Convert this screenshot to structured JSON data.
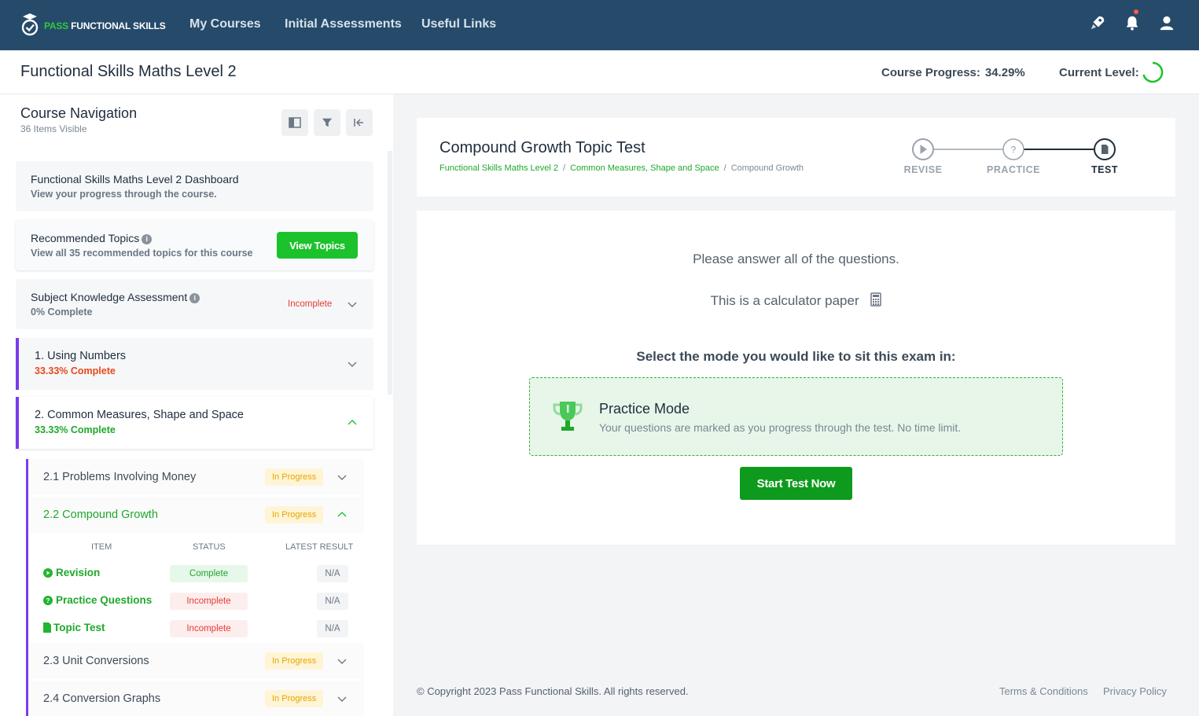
{
  "brand": {
    "logo_accent": "PASS",
    "logo_main": "FUNCTIONAL SKILLS"
  },
  "nav": {
    "my_courses": "My Courses",
    "initial_assessments": "Initial Assessments",
    "useful_links": "Useful Links"
  },
  "course": {
    "title": "Functional Skills Maths Level 2",
    "progress_label": "Course Progress:",
    "progress_value": "34.29%",
    "level_label": "Current Level:"
  },
  "sidebar": {
    "title": "Course Navigation",
    "subtitle": "36 Items Visible",
    "dashboard": {
      "title": "Functional Skills Maths Level 2 Dashboard",
      "subtitle": "View your progress through the course."
    },
    "recommended": {
      "title": "Recommended Topics",
      "subtitle": "View all 35 recommended topics for this course",
      "button": "View Topics"
    },
    "ska": {
      "title": "Subject Knowledge Assessment",
      "subtitle": "0% Complete",
      "status": "Incomplete"
    },
    "modules": [
      {
        "title": "1. Using Numbers",
        "progress": "33.33% Complete"
      },
      {
        "title": "2. Common Measures, Shape and Space",
        "progress": "33.33% Complete"
      }
    ],
    "topics": [
      {
        "title": "2.1 Problems Involving Money",
        "status": "In Progress"
      },
      {
        "title": "2.2 Compound Growth",
        "status": "In Progress"
      },
      {
        "title": "2.3 Unit Conversions",
        "status": "In Progress"
      },
      {
        "title": "2.4 Conversion Graphs",
        "status": "In Progress"
      }
    ],
    "table": {
      "headers": [
        "ITEM",
        "STATUS",
        "LATEST RESULT"
      ],
      "rows": [
        {
          "item": "Revision",
          "status": "Complete",
          "result": "N/A"
        },
        {
          "item": "Practice Questions",
          "status": "Incomplete",
          "result": "N/A"
        },
        {
          "item": "Topic Test",
          "status": "Incomplete",
          "result": "N/A"
        }
      ]
    }
  },
  "test": {
    "title": "Compound Growth Topic Test",
    "breadcrumb": [
      "Functional Skills Maths Level 2",
      "Common Measures, Shape and Space",
      "Compound Growth"
    ],
    "steps": [
      "REVISE",
      "PRACTICE",
      "TEST"
    ],
    "instruction1": "Please answer all of the questions.",
    "instruction2": "This is a calculator paper",
    "instruction3": "Select the mode you would like to sit this exam in:",
    "mode_title": "Practice Mode",
    "mode_desc": "Your questions are marked as you progress through the test. No time limit.",
    "start_button": "Start Test Now"
  },
  "footer": {
    "copyright": "© Copyright 2023 Pass Functional Skills. All rights reserved.",
    "terms": "Terms & Conditions",
    "privacy": "Privacy Policy"
  },
  "colors": {
    "nav_bg": "#254a6a",
    "accent_green": "#1cc22b",
    "module_purple": "#7c3aed",
    "status_red": "#e53b34",
    "status_yellow": "#e7a300"
  }
}
